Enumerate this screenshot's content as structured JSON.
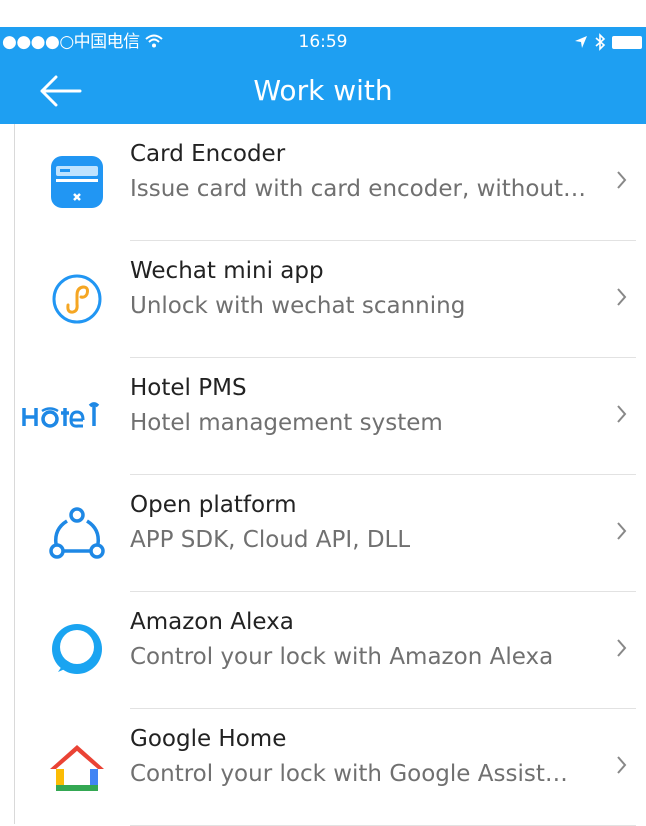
{
  "status_bar": {
    "carrier": "●●●●○中国电信",
    "time": "16:59"
  },
  "nav": {
    "title": "Work with"
  },
  "colors": {
    "primary": "#1e9ff2",
    "title_text": "#222222",
    "subtitle_text": "#707070"
  },
  "items": [
    {
      "title": "Card Encoder",
      "subtitle": "Issue card with card encoder, without…",
      "icon": "card-encoder-icon"
    },
    {
      "title": "Wechat mini app",
      "subtitle": "Unlock with wechat scanning",
      "icon": "wechat-mini-app-icon"
    },
    {
      "title": "Hotel PMS",
      "subtitle": "Hotel management system",
      "icon": "hotel-logo-icon"
    },
    {
      "title": "Open platform",
      "subtitle": "APP SDK, Cloud API, DLL",
      "icon": "open-platform-icon"
    },
    {
      "title": "Amazon Alexa",
      "subtitle": "Control your lock with Amazon Alexa",
      "icon": "alexa-icon"
    },
    {
      "title": "Google Home",
      "subtitle": "Control your lock with Google Assist…",
      "icon": "google-home-icon"
    }
  ]
}
